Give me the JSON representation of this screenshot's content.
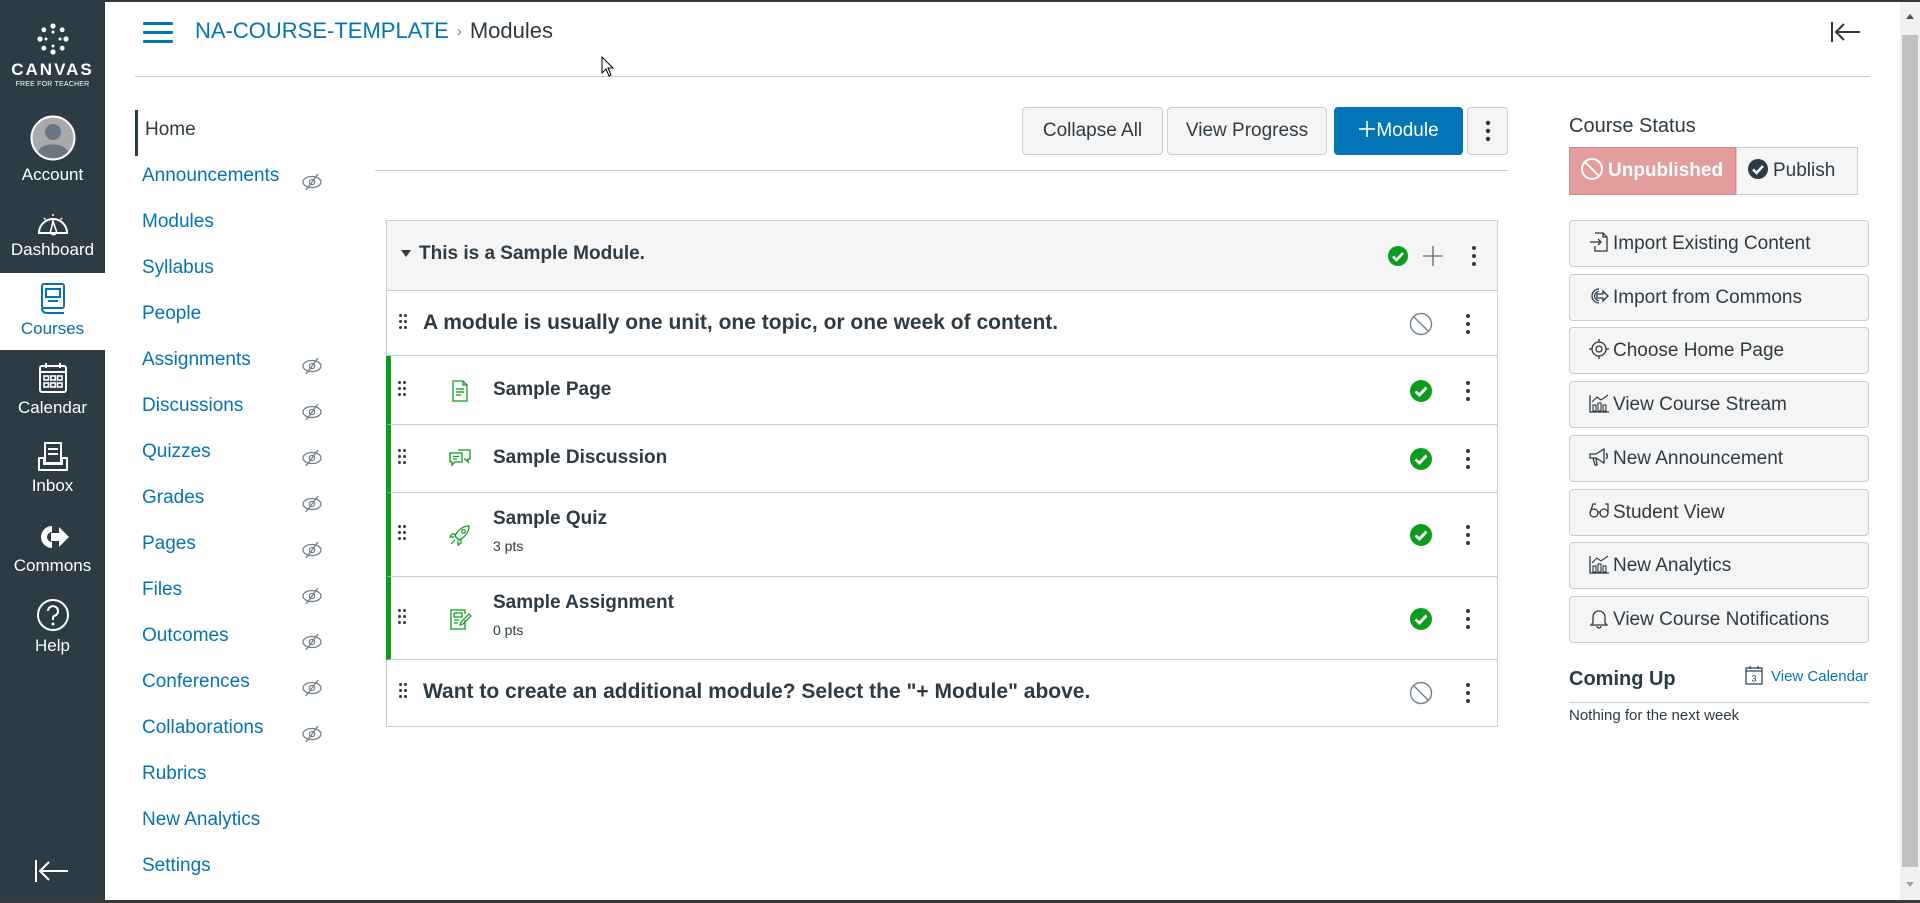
{
  "global_nav": {
    "logo": {
      "brand": "CANVAS",
      "sub": "FREE FOR TEACHER"
    },
    "items": [
      {
        "label": "Account",
        "icon": "avatar-icon",
        "active": false
      },
      {
        "label": "Dashboard",
        "icon": "dashboard-icon",
        "active": false
      },
      {
        "label": "Courses",
        "icon": "courses-icon",
        "active": true
      },
      {
        "label": "Calendar",
        "icon": "calendar-icon",
        "active": false
      },
      {
        "label": "Inbox",
        "icon": "inbox-icon",
        "active": false
      },
      {
        "label": "Commons",
        "icon": "commons-icon",
        "active": false
      },
      {
        "label": "Help",
        "icon": "help-icon",
        "active": false
      }
    ],
    "collapse_icon": "collapse-nav-icon"
  },
  "header": {
    "breadcrumb": [
      {
        "label": "NA-COURSE-TEMPLATE",
        "link": true
      },
      {
        "label": "Modules",
        "link": false
      }
    ],
    "separator": "›"
  },
  "course_nav": {
    "items": [
      {
        "label": "Home",
        "active": true,
        "hidden": false
      },
      {
        "label": "Announcements",
        "active": false,
        "hidden": true
      },
      {
        "label": "Modules",
        "active": false,
        "hidden": false
      },
      {
        "label": "Syllabus",
        "active": false,
        "hidden": false
      },
      {
        "label": "People",
        "active": false,
        "hidden": false
      },
      {
        "label": "Assignments",
        "active": false,
        "hidden": true
      },
      {
        "label": "Discussions",
        "active": false,
        "hidden": true
      },
      {
        "label": "Quizzes",
        "active": false,
        "hidden": true
      },
      {
        "label": "Grades",
        "active": false,
        "hidden": true
      },
      {
        "label": "Pages",
        "active": false,
        "hidden": true
      },
      {
        "label": "Files",
        "active": false,
        "hidden": true
      },
      {
        "label": "Outcomes",
        "active": false,
        "hidden": true
      },
      {
        "label": "Conferences",
        "active": false,
        "hidden": true
      },
      {
        "label": "Collaborations",
        "active": false,
        "hidden": true
      },
      {
        "label": "Rubrics",
        "active": false,
        "hidden": false
      },
      {
        "label": "New Analytics",
        "active": false,
        "hidden": false
      },
      {
        "label": "Settings",
        "active": false,
        "hidden": false
      }
    ]
  },
  "toolbar": {
    "collapse_all": "Collapse All",
    "view_progress": "View Progress",
    "add_module": "Module",
    "add_module_prefix": "+"
  },
  "module": {
    "title": "This is a Sample Module.",
    "published": true,
    "rows": [
      {
        "type": "subheader",
        "text": "A module is usually one unit, one topic, or one week of content.",
        "published": false
      },
      {
        "type": "page",
        "title": "Sample Page",
        "points": "",
        "published": true
      },
      {
        "type": "discussion",
        "title": "Sample Discussion",
        "points": "",
        "published": true
      },
      {
        "type": "quiz",
        "title": "Sample Quiz",
        "points": "3 pts",
        "published": true
      },
      {
        "type": "assignment",
        "title": "Sample Assignment",
        "points": "0 pts",
        "published": true
      },
      {
        "type": "subheader",
        "text": "Want to create an additional module? Select the \"+ Module\" above.",
        "published": false
      }
    ],
    "accent_color": "#0b9d1e"
  },
  "sidebar": {
    "course_status_title": "Course Status",
    "unpublished_label": "Unpublished",
    "publish_label": "Publish",
    "actions": [
      {
        "label": "Import Existing Content",
        "icon": "import-icon"
      },
      {
        "label": "Import from Commons",
        "icon": "commons-icon"
      },
      {
        "label": "Choose Home Page",
        "icon": "target-icon"
      },
      {
        "label": "View Course Stream",
        "icon": "stream-chart-icon"
      },
      {
        "label": "New Announcement",
        "icon": "megaphone-icon"
      },
      {
        "label": "Student View",
        "icon": "glasses-icon"
      },
      {
        "label": "New Analytics",
        "icon": "analytics-chart-icon"
      },
      {
        "label": "View Course Notifications",
        "icon": "bell-icon"
      }
    ],
    "coming_up_title": "Coming Up",
    "view_calendar_label": "View Calendar",
    "calendar_day": "3",
    "coming_up_empty": "Nothing for the next week"
  },
  "colors": {
    "nav_bg": "#2d3b45",
    "link": "#0374b5",
    "primary_button": "#0374b5",
    "published_green": "#0b9d1e",
    "unpublished_bg": "#e39d9c"
  }
}
